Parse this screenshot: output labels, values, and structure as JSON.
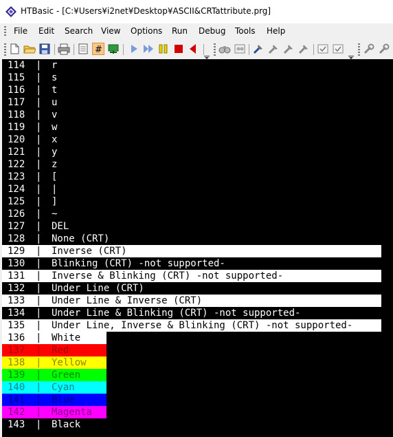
{
  "window": {
    "title": "HTBasic - [C:¥Users¥i2net¥Desktop¥ASCII&CRTattribute.prg]"
  },
  "menu": [
    "File",
    "Edit",
    "Search",
    "View",
    "Options",
    "Run",
    "Debug",
    "Tools",
    "Help"
  ],
  "toolbar": {
    "icons": [
      "new-file-icon",
      "open-folder-icon",
      "save-disk-icon",
      "print-icon",
      "document-icon",
      "line-number-hash-icon",
      "chart-icon",
      "run-play-icon",
      "step-play-icon",
      "continue-icon",
      "pause-icon",
      "stop-icon",
      "back-triangle-icon",
      "binoculars-icon",
      "binoculars-replace-icon",
      "tool-icon",
      "tool2-icon",
      "tool3-icon",
      "tool4-icon",
      "checkbox-window-icon",
      "checkbox-window2-icon",
      "wrench-icon",
      "wrench2-icon"
    ]
  },
  "editor": {
    "separator": "|",
    "rows": [
      {
        "num": "114",
        "text": "r"
      },
      {
        "num": "115",
        "text": "s"
      },
      {
        "num": "116",
        "text": "t"
      },
      {
        "num": "117",
        "text": "u"
      },
      {
        "num": "118",
        "text": "v"
      },
      {
        "num": "119",
        "text": "w"
      },
      {
        "num": "120",
        "text": "x"
      },
      {
        "num": "121",
        "text": "y"
      },
      {
        "num": "122",
        "text": "z"
      },
      {
        "num": "123",
        "text": "["
      },
      {
        "num": "124",
        "text": "|"
      },
      {
        "num": "125",
        "text": "]"
      },
      {
        "num": "126",
        "text": "~"
      },
      {
        "num": "127",
        "text": "DEL"
      },
      {
        "num": "128",
        "text": "None (CRT)"
      },
      {
        "num": "129",
        "text": "Inverse (CRT)",
        "style": "inverse"
      },
      {
        "num": "130",
        "text": "Blinking (CRT) -not supported-"
      },
      {
        "num": "131",
        "text": "Inverse & Blinking (CRT) -not supported-",
        "style": "inverse"
      },
      {
        "num": "132",
        "text": "Under Line (CRT)"
      },
      {
        "num": "133",
        "text": "Under Line & Inverse (CRT)",
        "style": "inverse"
      },
      {
        "num": "134",
        "text": "Under Line & Blinking (CRT) -not supported-"
      },
      {
        "num": "135",
        "text": "Under Line, Inverse & Blinking (CRT) -not supported-",
        "style": "inverse"
      },
      {
        "num": "136",
        "text": "White",
        "style": "color",
        "bg": "#ffffff",
        "fg": "#000000"
      },
      {
        "num": "137",
        "text": "Red",
        "style": "color",
        "bg": "#ff0000",
        "fg": "#a40000"
      },
      {
        "num": "138",
        "text": "Yellow",
        "style": "color",
        "bg": "#ffff00",
        "fg": "#8a8a00"
      },
      {
        "num": "139",
        "text": "Green",
        "style": "color",
        "bg": "#00ff00",
        "fg": "#008a00"
      },
      {
        "num": "140",
        "text": "Cyan",
        "style": "color",
        "bg": "#00ffff",
        "fg": "#008a8a"
      },
      {
        "num": "141",
        "text": "Blue",
        "style": "color",
        "bg": "#0000ff",
        "fg": "#00008a"
      },
      {
        "num": "142",
        "text": "Magenta",
        "style": "color",
        "bg": "#ff00ff",
        "fg": "#8a008a"
      },
      {
        "num": "143",
        "text": "Black"
      }
    ]
  }
}
